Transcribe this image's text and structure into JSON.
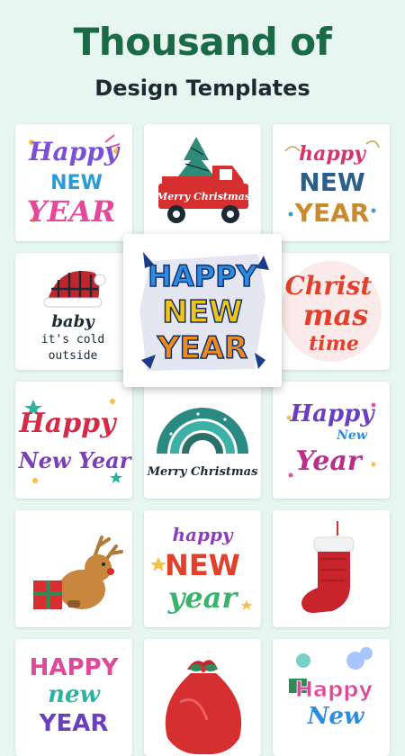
{
  "header": {
    "title": "Thousand of",
    "subtitle": "Design Templates"
  },
  "templates": [
    {
      "name": "happy-new-year-colorful",
      "lines": [
        "Happy",
        "NEW",
        "YEAR"
      ]
    },
    {
      "name": "merry-christmas-truck",
      "lines": [
        "Merry Christmas"
      ]
    },
    {
      "name": "happy-new-year-script",
      "lines": [
        "happy",
        "NEW",
        "YEAR"
      ]
    },
    {
      "name": "baby-its-cold-outside",
      "lines": [
        "baby",
        "it's cold",
        "outside"
      ]
    },
    {
      "name": "happy-new-year-featured",
      "lines": [
        "HAPPY",
        "NEW",
        "YEAR"
      ]
    },
    {
      "name": "christmas-time",
      "lines": [
        "Christ",
        "mas",
        "time"
      ]
    },
    {
      "name": "happy-new-year-stars",
      "lines": [
        "Happy",
        "New Year"
      ]
    },
    {
      "name": "merry-christmas-rainbow",
      "lines": [
        "Merry Christmas"
      ]
    },
    {
      "name": "happy-new-year-purple",
      "lines": [
        "Happy",
        "New",
        "Year"
      ]
    },
    {
      "name": "reindeer-gift",
      "lines": []
    },
    {
      "name": "happy-new-year-colors",
      "lines": [
        "happy",
        "NEW",
        "year"
      ]
    },
    {
      "name": "christmas-stocking",
      "lines": []
    },
    {
      "name": "happy-new-year-pink",
      "lines": [
        "HAPPY",
        "new",
        "YEAR"
      ]
    },
    {
      "name": "santa-bag",
      "lines": []
    },
    {
      "name": "happy-new-year-sticker",
      "lines": [
        "Happy",
        "New"
      ]
    }
  ],
  "colors": {
    "background": "#e8f6f1",
    "title": "#1a6b45",
    "subtitle": "#1b2a33",
    "card": "#ffffff"
  }
}
